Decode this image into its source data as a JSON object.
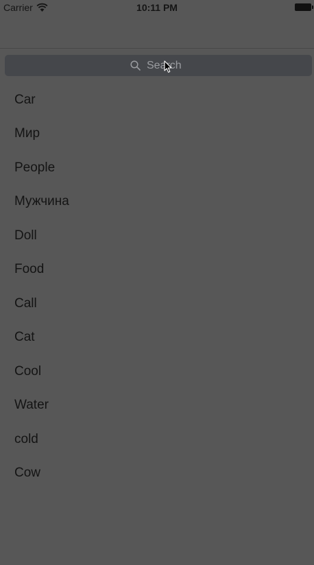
{
  "status_bar": {
    "carrier": "Carrier",
    "time": "10:11 PM"
  },
  "search": {
    "placeholder": "Search"
  },
  "list": {
    "items": [
      "Car",
      "Мир",
      "People",
      "Мужчина",
      "Doll",
      "Food",
      "Call",
      "Cat",
      "Cool",
      "Water",
      "cold",
      "Cow"
    ]
  },
  "colors": {
    "background": "#575757",
    "search_field": "#45474b",
    "text": "#141414",
    "placeholder": "#9b9da1"
  }
}
